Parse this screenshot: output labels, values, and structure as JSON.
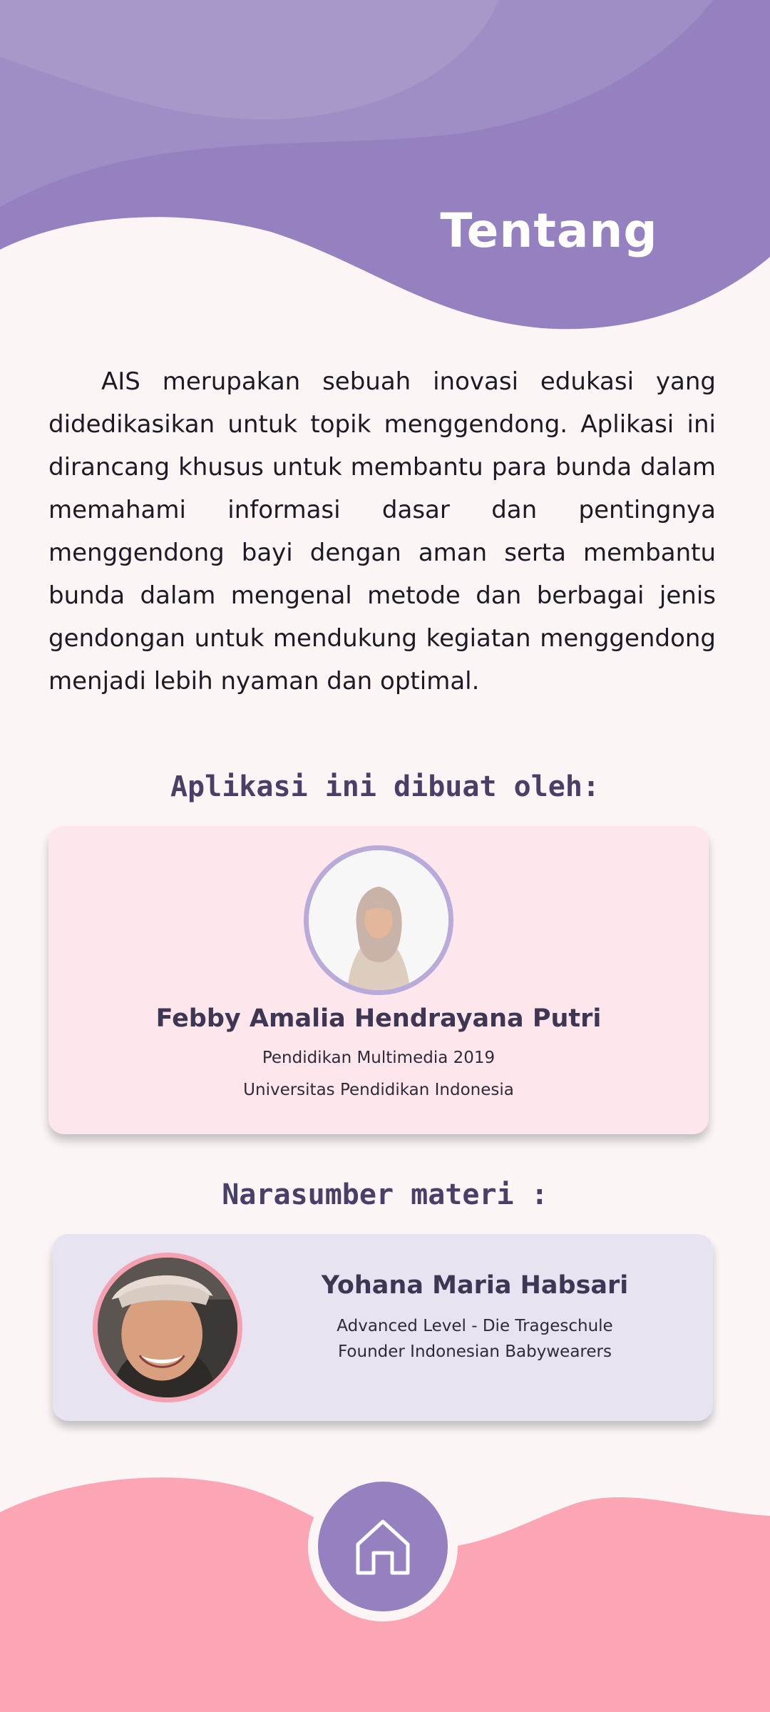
{
  "header": {
    "title": "Tentang"
  },
  "about": {
    "text": "AIS merupakan sebuah inovasi edukasi yang didedikasikan untuk topik menggendong. Aplikasi ini dirancang khusus untuk membantu para bunda dalam memahami informasi dasar dan pentingnya menggendong bayi dengan aman serta membantu bunda dalam mengenal metode dan berbagai jenis gendongan untuk mendukung kegiatan menggendong menjadi lebih nyaman dan optimal."
  },
  "creator": {
    "heading": "Aplikasi ini dibuat oleh:",
    "name": "Febby Amalia Hendrayana Putri",
    "line1": "Pendidikan Multimedia 2019",
    "line2": "Universitas Pendidikan Indonesia"
  },
  "source": {
    "heading": "Narasumber materi :",
    "name": "Yohana Maria Habsari",
    "line1": "Advanced Level - Die Trageschule",
    "line2": "Founder Indonesian Babywearers"
  },
  "nav": {
    "home_icon": "home-icon"
  },
  "colors": {
    "background": "#fbf5f6",
    "primary_purple": "#9581c0",
    "light_purple": "#a897c9",
    "pink_footer": "#fca6b5",
    "creator_card": "#fde7ec",
    "source_card": "#e8e3f1",
    "heading_text": "#4a3f66"
  }
}
